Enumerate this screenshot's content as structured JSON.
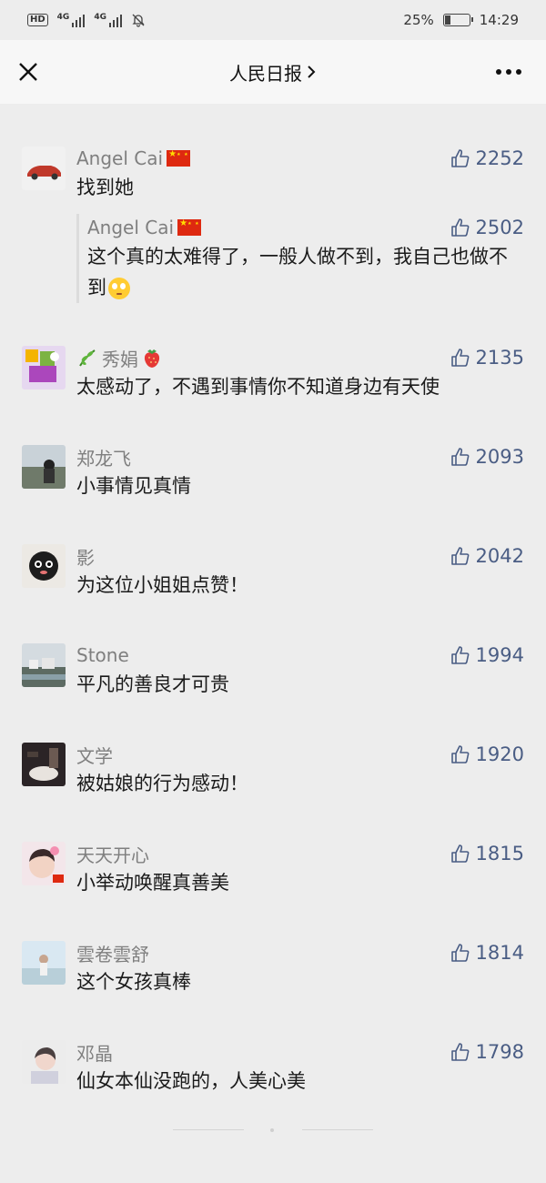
{
  "status_bar": {
    "hd": "HD",
    "network_1": "4G",
    "network_2": "4G",
    "battery_percent": "25%",
    "battery_level": 0.25,
    "time": "14:29",
    "icons": [
      "signal-icon",
      "signal-icon",
      "mute-bell-icon",
      "battery-icon"
    ]
  },
  "nav": {
    "title": "人民日报",
    "left_icon": "close-icon",
    "right_icon": "more-icon",
    "title_icon": "chevron-right-icon"
  },
  "colors": {
    "likes": "#4a5d84",
    "name": "#7f7f7f",
    "background": "#ededed"
  },
  "comments": [
    {
      "name": "Angel Cai",
      "name_emoji": "china-flag-icon",
      "likes": "2252",
      "text": "找到她",
      "reply": {
        "name": "Angel Cai",
        "name_emoji": "china-flag-icon",
        "likes": "2502",
        "text": "这个真的太难得了，一般人做不到，我自己也做不到",
        "text_emoji": "flushed-face-icon"
      }
    },
    {
      "name": "秀娟",
      "name_prefix_emoji": "herb-icon",
      "name_suffix_emoji": "strawberry-icon",
      "likes": "2135",
      "text": "太感动了，不遇到事情你不知道身边有天使"
    },
    {
      "name": "郑龙飞",
      "likes": "2093",
      "text": "小事情见真情"
    },
    {
      "name": "影",
      "likes": "2042",
      "text": "为这位小姐姐点赞！"
    },
    {
      "name": "Stone",
      "likes": "1994",
      "text": "平凡的善良才可贵"
    },
    {
      "name": "文学",
      "likes": "1920",
      "text": "被姑娘的行为感动！"
    },
    {
      "name": "天天开心",
      "likes": "1815",
      "text": "小举动唤醒真善美"
    },
    {
      "name": "雲卷雲舒",
      "likes": "1814",
      "text": "这个女孩真棒"
    },
    {
      "name": "邓晶",
      "likes": "1798",
      "text": "仙女本仙没跑的，人美心美"
    }
  ]
}
